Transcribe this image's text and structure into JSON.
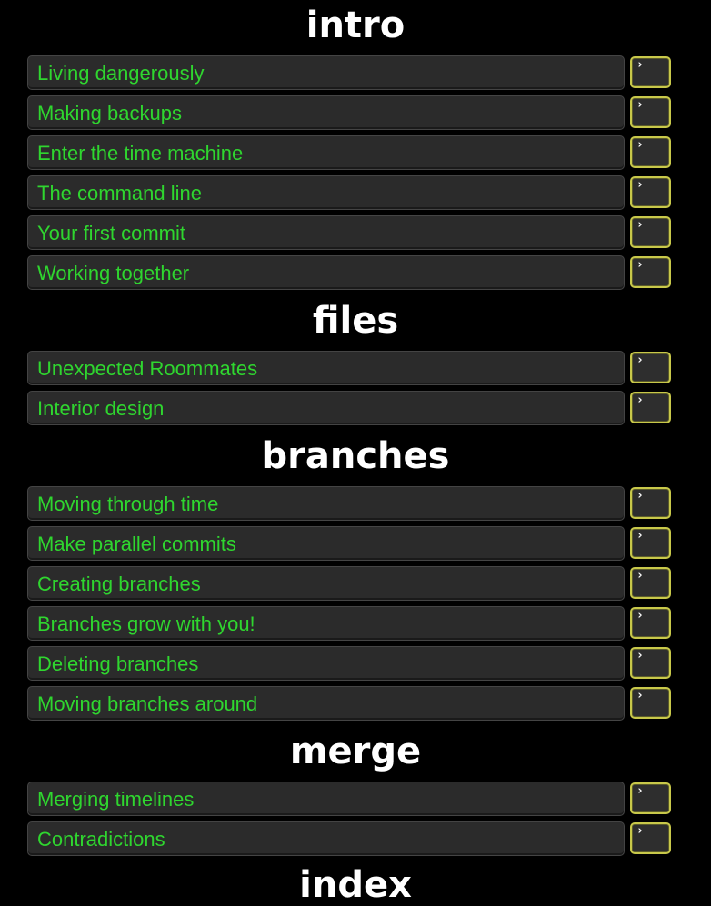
{
  "sections": [
    {
      "title": "intro",
      "levels": [
        {
          "label": "Living dangerously"
        },
        {
          "label": "Making backups"
        },
        {
          "label": "Enter the time machine"
        },
        {
          "label": "The command line"
        },
        {
          "label": "Your first commit"
        },
        {
          "label": "Working together"
        }
      ]
    },
    {
      "title": "files",
      "levels": [
        {
          "label": "Unexpected Roommates"
        },
        {
          "label": "Interior design"
        }
      ]
    },
    {
      "title": "branches",
      "levels": [
        {
          "label": "Moving through time"
        },
        {
          "label": "Make parallel commits"
        },
        {
          "label": "Creating branches"
        },
        {
          "label": "Branches grow with you!"
        },
        {
          "label": "Deleting branches"
        },
        {
          "label": "Moving branches around"
        }
      ]
    },
    {
      "title": "merge",
      "levels": [
        {
          "label": "Merging timelines"
        },
        {
          "label": "Contradictions"
        }
      ]
    },
    {
      "title": "index",
      "levels": []
    }
  ],
  "icons": {
    "terminal_button_icon": "terminal-prompt-icon",
    "prompt_glyph": "›"
  },
  "colors": {
    "background": "#000000",
    "section_title": "#ffffff",
    "level_text": "#2fd62f",
    "level_bg": "#2b2b2b",
    "button_border": "#c8c84a"
  }
}
